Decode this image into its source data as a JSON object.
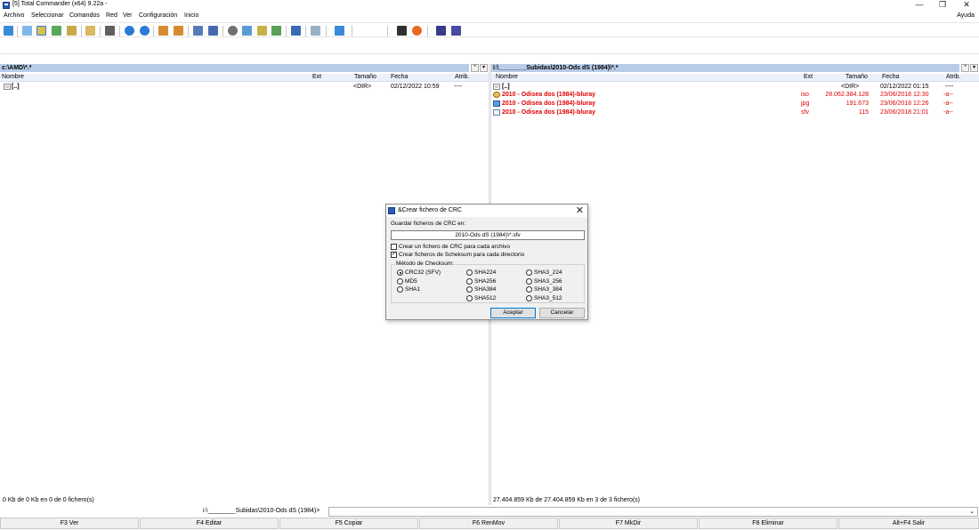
{
  "window": {
    "title": "[5] Total Commander (x64) 9.22a -",
    "min_glyph": "—",
    "max_glyph": "❐",
    "close_glyph": "✕"
  },
  "menu": {
    "items": [
      "Archivo",
      "Seleccionar",
      "Comandos",
      "Red",
      "Ver",
      "Configuración",
      "Inicio"
    ],
    "help": "Ayuda"
  },
  "left_panel": {
    "path": "c:\\AMD\\*.*",
    "columns": {
      "name": "Nombre",
      "ext": "Ext",
      "size": "Tamaño",
      "date": "Fecha",
      "attr": "Atrib."
    },
    "rows": [
      {
        "name": "[..]",
        "ext": "",
        "size": "<DIR>",
        "date": "02/12/2022 10:59",
        "attr": "----"
      }
    ],
    "status": "0 Kb de 0 Kb en 0 de 0 fichero(s)"
  },
  "right_panel": {
    "path": "i:\\________Subidas\\2010-Ods dS (1984)\\*.*",
    "columns": {
      "name": "Nombre",
      "ext": "Ext",
      "size": "Tamaño",
      "date": "Fecha",
      "attr": "Atrib."
    },
    "rows": [
      {
        "name": "[..]",
        "ext": "",
        "size": "<DIR>",
        "date": "02/12/2022 01:15",
        "attr": "----",
        "selected": false
      },
      {
        "name": "2010 - Odisea dos (1984)-bluray",
        "ext": "iso",
        "size": "28.062.384.128",
        "date": "23/06/2018 12:30",
        "attr": "-a--",
        "selected": true
      },
      {
        "name": "2010 - Odisea dos (1984)-bluray",
        "ext": "jpg",
        "size": "191.673",
        "date": "23/06/2018 12:26",
        "attr": "-a--",
        "selected": true
      },
      {
        "name": "2010 - Odisea dos (1984)-bluray",
        "ext": "sfv",
        "size": "115",
        "date": "23/06/2018 21:01",
        "attr": "-a--",
        "selected": true
      }
    ],
    "status": "27.404.859 Kb de 27.404.859 Kb en 3 de 3 fichero(s)"
  },
  "command_line": {
    "prompt": "i:\\________Subidas\\2010-Ods dS (1984)>",
    "value": ""
  },
  "function_keys": [
    "F3 Ver",
    "F4 Editar",
    "F5 Copiar",
    "F6 RenMov",
    "F7 MkDir",
    "F8 Eliminar",
    "Alt+F4 Salir"
  ],
  "dialog": {
    "title": "&Crear fichero de CRC",
    "save_label": "Guardar ficheros de CRC en:",
    "save_value": "2010-Ods dS (1984)\\*.sfv",
    "checkbox1": {
      "label": "Crear un fichero de CRC para cada archivo",
      "checked": false
    },
    "checkbox2": {
      "label": "Crear ficheros de Scheksum para cada directorio",
      "checked": true
    },
    "group_title": "Método de Checksum:",
    "methods_col1": [
      "CRC32 (SFV)",
      "MD5",
      "SHA1"
    ],
    "methods_col2": [
      "SHA224",
      "SHA256",
      "SHA384",
      "SHA512"
    ],
    "methods_col3": [
      "SHA3_224",
      "SHA3_256",
      "SHA3_384",
      "SHA3_512"
    ],
    "selected_method": "CRC32 (SFV)",
    "ok": "Aceptar",
    "cancel": "Cancelar",
    "check_glyph": "✓"
  },
  "colors": {
    "selected_file": "#e00000",
    "path_bar": "#b8cce8",
    "accent": "#0078d7"
  }
}
